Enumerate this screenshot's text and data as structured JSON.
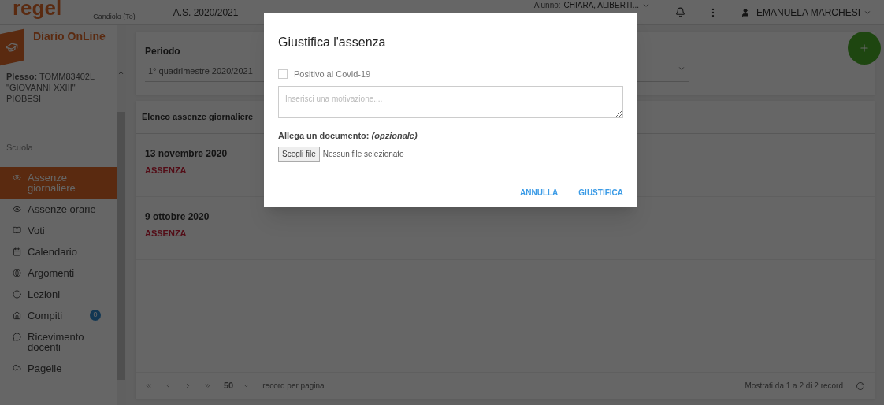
{
  "header": {
    "logo": "regel",
    "school": "Candiolo (To)",
    "year": "A.S. 2020/2021",
    "student_label": "Alunno:",
    "student": "CHIARA, ALIBERTI...",
    "user": "EMANUELA MARCHESI"
  },
  "sidebar": {
    "title": "Diario OnLine",
    "plesso_label": "Plesso:",
    "plesso": "TOMM83402L \"GIOVANNI XXIII\" PIOBESI",
    "section": "Scuola",
    "items": [
      {
        "label": "Assenze giornaliere",
        "selected": true
      },
      {
        "label": "Assenze orarie",
        "selected": false
      },
      {
        "label": "Voti",
        "selected": false
      },
      {
        "label": "Calendario",
        "selected": false
      },
      {
        "label": "Argomenti",
        "selected": false
      },
      {
        "label": "Lezioni",
        "selected": false
      },
      {
        "label": "Compiti",
        "selected": false,
        "badge": "0"
      },
      {
        "label": "Ricevimento docenti",
        "selected": false
      },
      {
        "label": "Pagelle",
        "selected": false
      }
    ]
  },
  "period": {
    "label": "Periodo",
    "value": "1° quadrimestre 2020/2021"
  },
  "list": {
    "title": "Elenco assenze giornaliere",
    "rows": [
      {
        "date": "13 novembre 2020",
        "type": "ASSENZA"
      },
      {
        "date": "9 ottobre 2020",
        "type": "ASSENZA"
      }
    ]
  },
  "pager": {
    "page_size": "50",
    "page_size_label": "record per pagina",
    "summary": "Mostrati da 1 a 2 di 2 record"
  },
  "dialog": {
    "title": "Giustifica l'assenza",
    "covid": {
      "label": "Positivo al Covid-19",
      "checked": false
    },
    "reason_placeholder": "Inserisci una motivazione....",
    "attach_label": "Allega un documento: *(opzionale)*",
    "file_button": "Scegli file",
    "file_status": "Nessun file selezionato",
    "buttons": [
      "ANNULLA",
      "GIUSTIFICA"
    ]
  }
}
